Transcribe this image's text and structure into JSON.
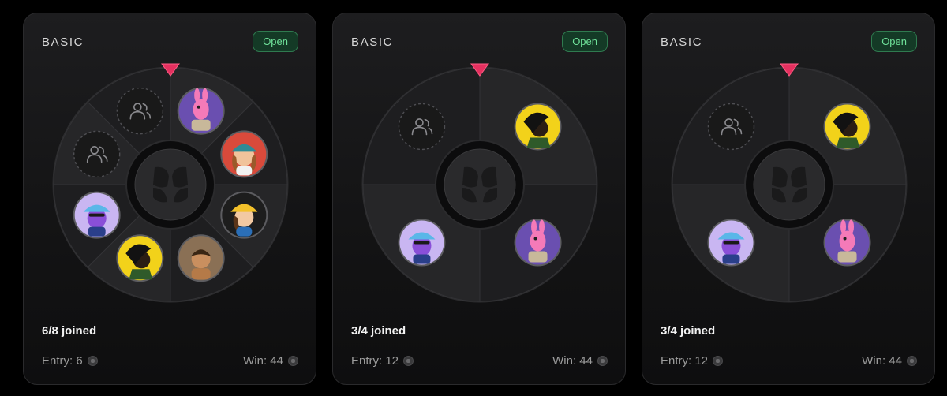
{
  "colors": {
    "open_badge_bg": "#143a26",
    "open_badge_text": "#6fe29a",
    "pointer": "#e5305f",
    "card_bg": "#1a1a1c"
  },
  "cards": [
    {
      "tier": "BASIC",
      "status": "Open",
      "joined": "6/8 joined",
      "entry_label": "Entry: 6",
      "win_label": "Win: 44",
      "slots": [
        {
          "type": "player",
          "avatar": "pink-bunny-avatar",
          "bg": "#6a4fb0"
        },
        {
          "type": "player",
          "avatar": "cap-girl-avatar",
          "bg": "#d94a3b"
        },
        {
          "type": "player",
          "avatar": "yellow-hat-girl-avatar",
          "bg": "#1d1d1d"
        },
        {
          "type": "player",
          "avatar": "tanned-boy-avatar",
          "bg": "#8a7055"
        },
        {
          "type": "player",
          "avatar": "dark-hair-boy-avatar",
          "bg": "#f2d21a"
        },
        {
          "type": "player",
          "avatar": "purple-blob-bucket-hat-avatar",
          "bg": "#c9b6f2"
        },
        {
          "type": "empty",
          "avatar": "users-icon"
        },
        {
          "type": "empty",
          "avatar": "users-icon"
        }
      ]
    },
    {
      "tier": "BASIC",
      "status": "Open",
      "joined": "3/4 joined",
      "entry_label": "Entry: 12",
      "win_label": "Win: 44",
      "slots": [
        {
          "type": "player",
          "avatar": "dark-hair-boy-avatar",
          "bg": "#f2d21a"
        },
        {
          "type": "player",
          "avatar": "pink-bunny-avatar",
          "bg": "#6a4fb0"
        },
        {
          "type": "player",
          "avatar": "purple-blob-bucket-hat-avatar",
          "bg": "#c9b6f2"
        },
        {
          "type": "empty",
          "avatar": "users-icon"
        }
      ]
    },
    {
      "tier": "BASIC",
      "status": "Open",
      "joined": "3/4 joined",
      "entry_label": "Entry: 12",
      "win_label": "Win: 44",
      "slots": [
        {
          "type": "player",
          "avatar": "dark-hair-boy-avatar",
          "bg": "#f2d21a"
        },
        {
          "type": "player",
          "avatar": "pink-bunny-avatar",
          "bg": "#6a4fb0"
        },
        {
          "type": "player",
          "avatar": "purple-blob-bucket-hat-avatar",
          "bg": "#c9b6f2"
        },
        {
          "type": "empty",
          "avatar": "users-icon"
        }
      ]
    }
  ]
}
